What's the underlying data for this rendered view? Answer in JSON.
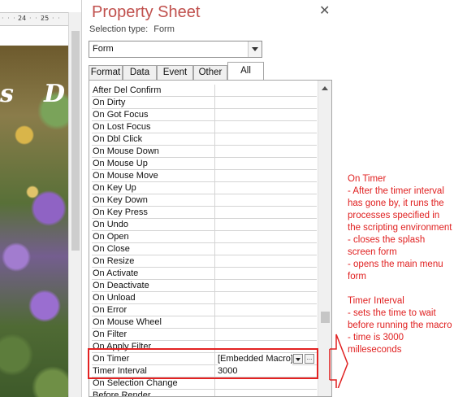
{
  "ruler": {
    "tick1": "24",
    "tick2": "25"
  },
  "splash_text": {
    "left": "s",
    "right": "D"
  },
  "property_sheet": {
    "title": "Property Sheet",
    "close_glyph": "✕",
    "selection_type_label": "Selection type:",
    "selection_type_value": "Form",
    "object_combo_value": "Form",
    "tabs": [
      "Format",
      "Data",
      "Event",
      "Other",
      "All"
    ],
    "active_tab": "All",
    "properties": [
      {
        "name": "After Del Confirm",
        "value": ""
      },
      {
        "name": "On Dirty",
        "value": ""
      },
      {
        "name": "On Got Focus",
        "value": ""
      },
      {
        "name": "On Lost Focus",
        "value": ""
      },
      {
        "name": "On Dbl Click",
        "value": ""
      },
      {
        "name": "On Mouse Down",
        "value": ""
      },
      {
        "name": "On Mouse Up",
        "value": ""
      },
      {
        "name": "On Mouse Move",
        "value": ""
      },
      {
        "name": "On Key Up",
        "value": ""
      },
      {
        "name": "On Key Down",
        "value": ""
      },
      {
        "name": "On Key Press",
        "value": ""
      },
      {
        "name": "On Undo",
        "value": ""
      },
      {
        "name": "On Open",
        "value": ""
      },
      {
        "name": "On Close",
        "value": ""
      },
      {
        "name": "On Resize",
        "value": ""
      },
      {
        "name": "On Activate",
        "value": ""
      },
      {
        "name": "On Deactivate",
        "value": ""
      },
      {
        "name": "On Unload",
        "value": ""
      },
      {
        "name": "On Error",
        "value": ""
      },
      {
        "name": "On Mouse Wheel",
        "value": ""
      },
      {
        "name": "On Filter",
        "value": ""
      },
      {
        "name": "On Apply Filter",
        "value": ""
      },
      {
        "name": "On Timer",
        "value": "[Embedded Macro]"
      },
      {
        "name": "Timer Interval",
        "value": "3000"
      },
      {
        "name": "On Selection Change",
        "value": ""
      },
      {
        "name": "Before Render",
        "value": ""
      }
    ],
    "builder_button_label": "...",
    "dropdown_icon": "chevron-down-icon"
  },
  "annotation": {
    "on_timer_title": "On Timer",
    "on_timer_lines": "- After the timer interval has gone by, it runs the processes specified in the scripting environment\n- closes the splash screen form\n- opens the main menu form",
    "timer_interval_title": "Timer Interval",
    "timer_interval_lines": "- sets the time to wait before running the macro\n- time is 3000 milleseconds",
    "color": "#e02020"
  },
  "colors": {
    "title": "#c0504d",
    "highlight": "#e32222"
  }
}
